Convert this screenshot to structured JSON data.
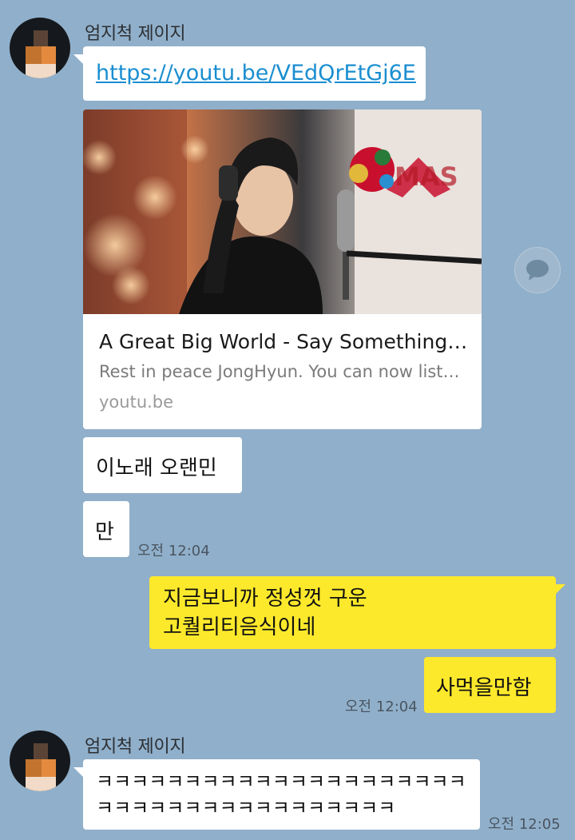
{
  "messages": {
    "sender_name": "엄지척 제이지",
    "link_url": "https://youtu.be/VEdQrEtGj6E",
    "card": {
      "title": "A Great Big World - Say Something…",
      "description": "Rest in peace JongHyun. You can now list…",
      "domain": "youtu.be"
    },
    "msg1": "이노래 오랜민",
    "msg2": "만",
    "time1": "오전 12:04",
    "my_msg1_line1": "지금보니까 정성껏 구운",
    "my_msg1_line2": "고퀄리티음식이네",
    "my_msg2": "사먹을만함",
    "time2": "오전 12:04",
    "sender_name_2": "엄지척 제이지",
    "laugh_line1": "ㅋㅋㅋㅋㅋㅋㅋㅋㅋㅋㅋㅋㅋㅋㅋㅋㅋㅋㅋㅋㅋ",
    "laugh_line2": "ㅋㅋㅋㅋㅋㅋㅋㅋㅋㅋㅋㅋㅋㅋㅋㅋㅋ",
    "time3": "오전 12:05"
  },
  "colors": {
    "background": "#90afca",
    "my_bubble": "#fde92b",
    "other_bubble": "#ffffff",
    "link": "#1a8ed0"
  },
  "icons": {
    "share": "speech-bubble-icon"
  }
}
